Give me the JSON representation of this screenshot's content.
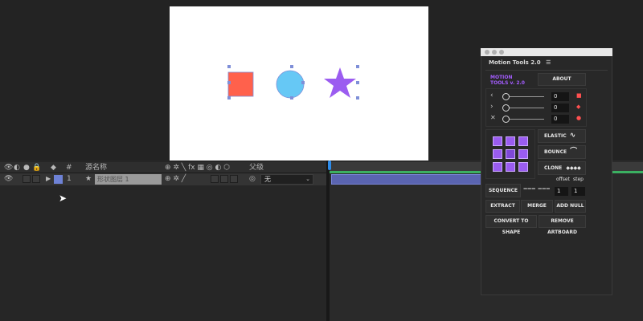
{
  "composition": {
    "background": "#ffffff",
    "shapes": [
      {
        "name": "square",
        "color": "#ff614c"
      },
      {
        "name": "circle",
        "color": "#66c8f5"
      },
      {
        "name": "star",
        "color": "#9b5cf0"
      }
    ]
  },
  "timeline": {
    "header": {
      "hash": "#",
      "source_name": "源名称",
      "parent": "父级"
    },
    "layers": [
      {
        "index": "1",
        "name": "形状图层 1",
        "parent_value": "无",
        "label_color": "#6e82d6"
      }
    ],
    "playhead_color": "#2d8ceb",
    "work_area_color": "#3bb061"
  },
  "panel": {
    "title": "Motion Tools 2.0",
    "menu_icon": "hamburger-icon",
    "logo_line1": "MOTION",
    "logo_line2": "TOOLS v. 2.0",
    "logo_color": "#a45cff",
    "about": "ABOUT",
    "sliders": [
      {
        "icon": "ease-in-icon",
        "glyph": "‹",
        "value": "0",
        "indicator": "■",
        "color": "#ff5050"
      },
      {
        "icon": "ease-out-icon",
        "glyph": "›",
        "value": "0",
        "indicator": "◆",
        "color": "#ff5050"
      },
      {
        "icon": "ease-both-icon",
        "glyph": "✕",
        "value": "0",
        "indicator": "●",
        "color": "#ff5050"
      }
    ],
    "elastic": "ELASTIC",
    "bounce": "BOUNCE",
    "clone": "CLONE",
    "offset": "offset",
    "step": "step",
    "sequence": "SEQUENCE",
    "offset_value": "1",
    "step_value": "1",
    "extract": "EXTRACT",
    "merge": "MERGE",
    "add_null": "ADD NULL",
    "convert_to_shape": "CONVERT TO SHAPE",
    "remove_artboard": "REMOVE ARTBOARD"
  }
}
